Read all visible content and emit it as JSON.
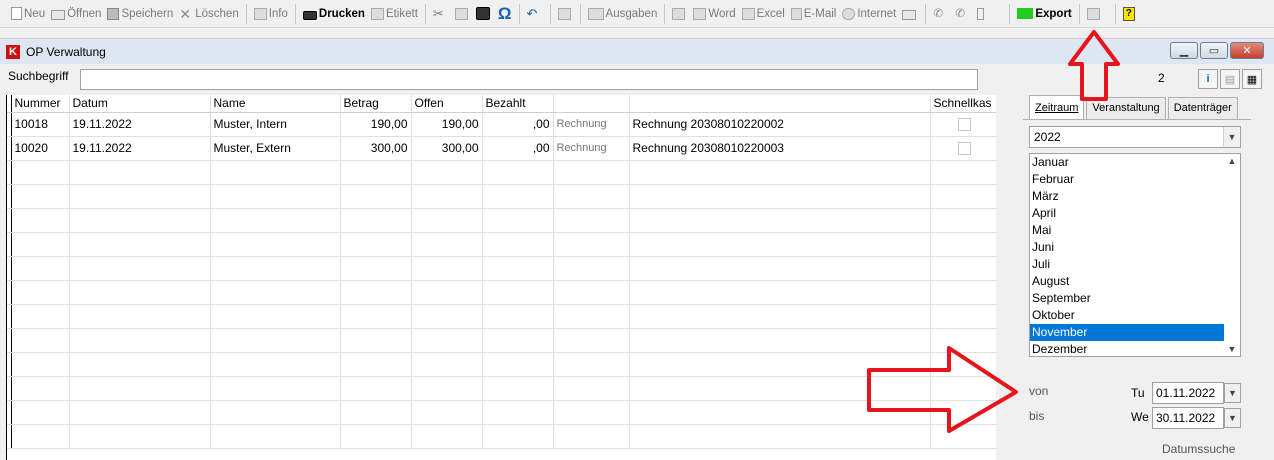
{
  "toolbar": {
    "neu": "Neu",
    "oeffnen": "Öffnen",
    "speichern": "Speichern",
    "loeschen": "Löschen",
    "info": "Info",
    "drucken": "Drucken",
    "etikett": "Etikett",
    "omega": "Ω",
    "ausgaben": "Ausgaben",
    "word": "Word",
    "excel": "Excel",
    "email": "E-Mail",
    "internet": "Internet",
    "export": "Export"
  },
  "window": {
    "logo": "K",
    "title": "OP Verwaltung"
  },
  "search": {
    "label": "Suchbegriff",
    "value": "",
    "count": "2"
  },
  "table": {
    "columns": [
      "Nummer",
      "Datum",
      "Name",
      "Betrag",
      "Offen",
      "Bezahlt",
      "",
      "",
      "Schnellkas"
    ],
    "rows": [
      {
        "nummer": "10018",
        "datum": "19.11.2022",
        "name": "Muster, Intern",
        "betrag": "190,00",
        "offen": "190,00",
        "bezahlt": ",00",
        "typ": "Rechnung",
        "beschreibung": "Rechnung 20308010220002"
      },
      {
        "nummer": "10020",
        "datum": "19.11.2022",
        "name": "Muster, Extern",
        "betrag": "300,00",
        "offen": "300,00",
        "bezahlt": ",00",
        "typ": "Rechnung",
        "beschreibung": "Rechnung 20308010220003"
      }
    ]
  },
  "panel": {
    "tabs": [
      "Zeitraum",
      "Veranstaltung",
      "Datenträger"
    ],
    "active_tab": "Zeitraum",
    "year": "2022",
    "months": [
      "Januar",
      "Februar",
      "März",
      "April",
      "Mai",
      "Juni",
      "Juli",
      "August",
      "September",
      "Oktober",
      "November",
      "Dezember"
    ],
    "selected_month": "November",
    "von_label": "von",
    "bis_label": "bis",
    "von_day": "Tu",
    "bis_day": "We",
    "von_date": "01.11.2022",
    "bis_date": "30.11.2022",
    "datumssuche": "Datumssuche"
  },
  "colors": {
    "annotation_arrow": "#e8141c",
    "selection": "#0078d7",
    "export_icon": "#22cc22"
  }
}
